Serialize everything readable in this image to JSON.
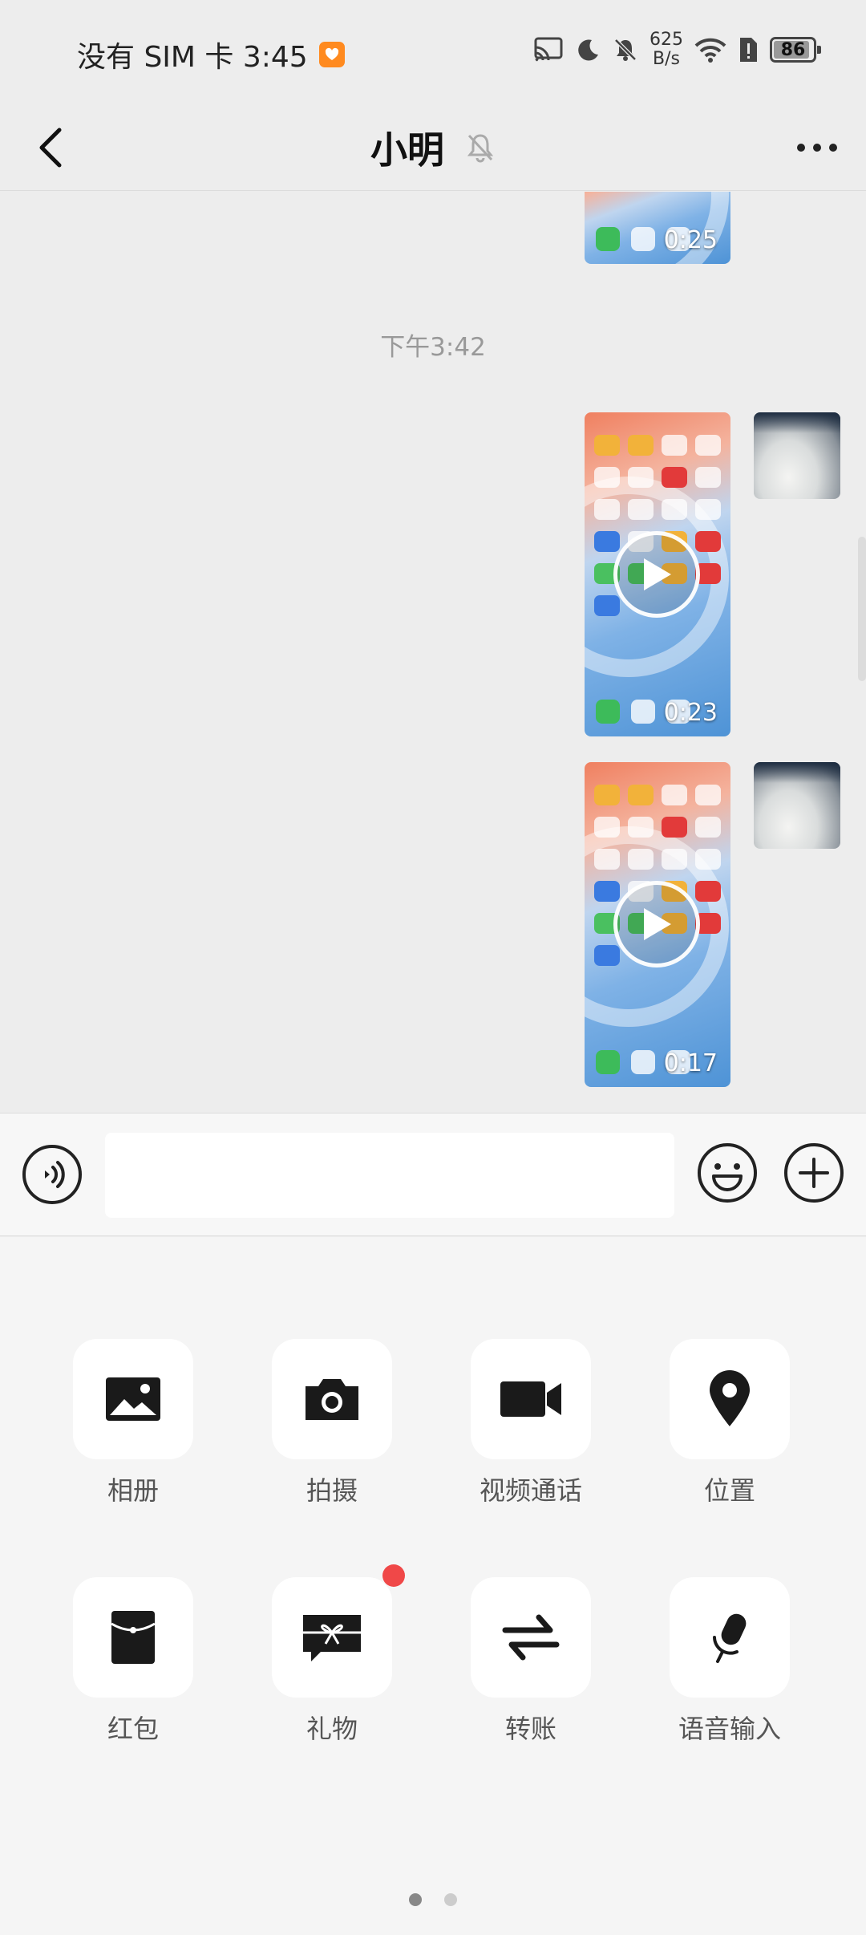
{
  "status_bar": {
    "carrier_time": "没有 SIM 卡 3:45",
    "net_speed_value": "625",
    "net_speed_unit": "B/s",
    "battery": "86"
  },
  "header": {
    "back_icon": "chevron-left-icon",
    "title": "小明",
    "mute_icon": "bell-off-icon",
    "more_icon": "more-dots-icon"
  },
  "chat": {
    "timestamp": "下午3:42",
    "messages": [
      {
        "type": "video",
        "duration": "0:25",
        "sender": "self"
      },
      {
        "type": "video",
        "duration": "0:23",
        "sender": "self"
      },
      {
        "type": "video",
        "duration": "0:17",
        "sender": "self"
      }
    ]
  },
  "input_bar": {
    "voice_icon": "voice-input-icon",
    "text_value": "",
    "emoji_icon": "emoji-icon",
    "plus_icon": "plus-icon"
  },
  "panel": {
    "items": [
      {
        "label": "相册",
        "icon": "photo-album-icon"
      },
      {
        "label": "拍摄",
        "icon": "camera-icon"
      },
      {
        "label": "视频通话",
        "icon": "video-call-icon"
      },
      {
        "label": "位置",
        "icon": "location-pin-icon"
      },
      {
        "label": "红包",
        "icon": "red-packet-icon"
      },
      {
        "label": "礼物",
        "icon": "gift-icon",
        "badge": true
      },
      {
        "label": "转账",
        "icon": "transfer-icon"
      },
      {
        "label": "语音输入",
        "icon": "microphone-icon"
      }
    ],
    "page_count": 2,
    "active_page": 1
  },
  "colors": {
    "background": "#ededed",
    "panel": "#f5f5f5",
    "badge": "#f04848"
  }
}
